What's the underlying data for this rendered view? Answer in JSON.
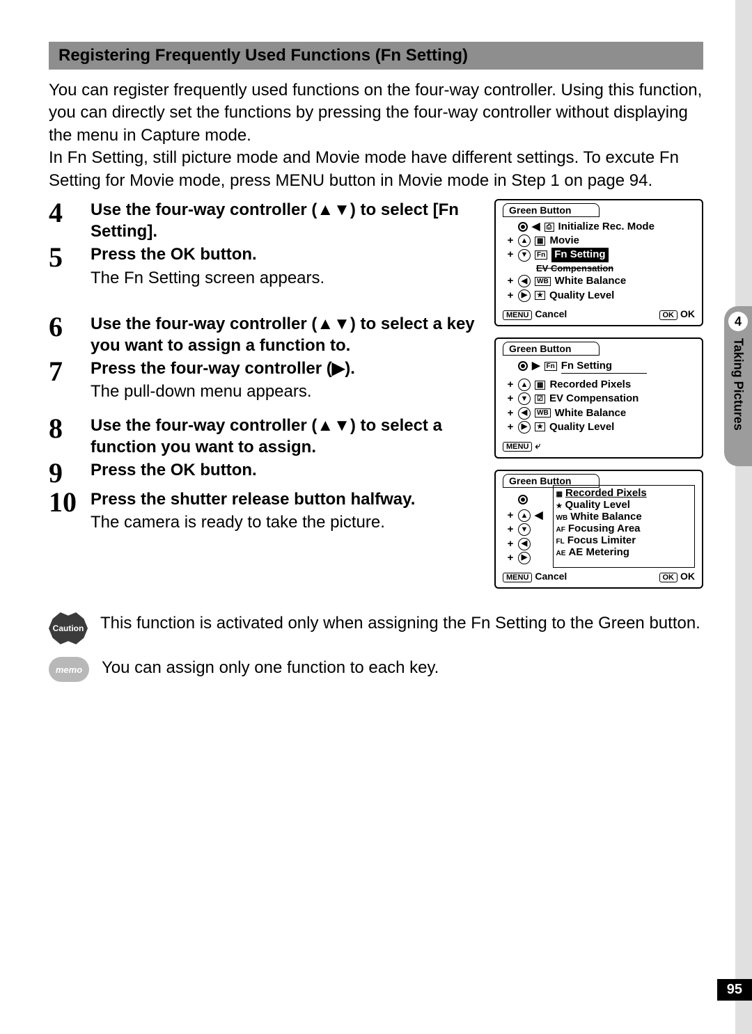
{
  "section_title": "Registering Frequently Used Functions (Fn Setting)",
  "intro": "You can register frequently used functions on the four-way controller. Using this function, you can directly set the functions by pressing the four-way controller without displaying the menu in Capture mode.\nIn Fn Setting, still picture mode and Movie mode have different settings. To excute Fn Setting for Movie mode, press MENU button in Movie mode in Step 1 on page 94.",
  "steps": [
    {
      "num": "4",
      "head": "Use the four-way controller (▲▼) to select [Fn Setting]."
    },
    {
      "num": "5",
      "head": "Press the OK button.",
      "desc": "The Fn Setting screen appears."
    },
    {
      "num": "6",
      "head": "Use the four-way controller (▲▼) to select a key you want to assign a function to."
    },
    {
      "num": "7",
      "head": "Press the four-way controller (▶).",
      "desc": "The pull-down menu appears."
    },
    {
      "num": "8",
      "head": "Use the four-way controller (▲▼) to select a function you want to assign."
    },
    {
      "num": "9",
      "head": "Press the OK button."
    },
    {
      "num": "10",
      "head": "Press the shutter release button halfway.",
      "desc": "The camera is ready to take the picture."
    }
  ],
  "fig1": {
    "tab": "Green Button",
    "rows": [
      {
        "sym": "dot",
        "icon": "◀",
        "icon2": "⎙",
        "label": "Initialize Rec. Mode"
      },
      {
        "sym": "up",
        "plus": "+",
        "icon2": "▦",
        "label": "Movie"
      },
      {
        "sym": "down",
        "plus": "+",
        "icon2": "Fn",
        "label": "Fn Setting",
        "sel": true
      },
      {
        "strike": "EV Compensation"
      },
      {
        "sym": "left",
        "plus": "+",
        "icon2": "WB",
        "label": "White Balance"
      },
      {
        "sym": "right",
        "plus": "+",
        "icon2": "★",
        "label": "Quality Level"
      }
    ],
    "footer_left_btn": "MENU",
    "footer_left": "Cancel",
    "footer_right_btn": "OK",
    "footer_right": "OK"
  },
  "fig2": {
    "tab": "Green Button",
    "navline": {
      "icon": "Fn",
      "label": "Fn Setting"
    },
    "rows": [
      {
        "sym": "up",
        "plus": "+",
        "icon2": "▦",
        "label": "Recorded Pixels"
      },
      {
        "sym": "down",
        "plus": "+",
        "icon2": "☑",
        "label": "EV Compensation"
      },
      {
        "sym": "left",
        "plus": "+",
        "icon2": "WB",
        "label": "White Balance"
      },
      {
        "sym": "right",
        "plus": "+",
        "icon2": "★",
        "label": "Quality Level"
      }
    ],
    "footer_left_btn": "MENU",
    "footer_back": "⤶"
  },
  "fig3": {
    "tab": "Green Button",
    "toprow": {
      "sym": "dot"
    },
    "dropdown": [
      {
        "ico": "▦",
        "label": "Recorded Pixels",
        "sel": true
      },
      {
        "ico": "★",
        "label": "Quality Level"
      },
      {
        "ico": "WB",
        "label": "White Balance"
      },
      {
        "ico": "AF",
        "label": "Focusing Area"
      },
      {
        "ico": "FL",
        "label": "Focus Limiter"
      },
      {
        "ico": "AE",
        "label": "AE Metering"
      }
    ],
    "siderows": [
      {
        "sym": "up",
        "plus": "+"
      },
      {
        "sym": "down",
        "plus": "+"
      },
      {
        "sym": "left",
        "plus": "+"
      },
      {
        "sym": "right",
        "plus": "+"
      }
    ],
    "footer_left_btn": "MENU",
    "footer_left": "Cancel",
    "footer_right_btn": "OK",
    "footer_right": "OK"
  },
  "sidebar": {
    "num": "4",
    "label": "Taking Pictures"
  },
  "caution": "This function is activated only when assigning the Fn Setting to the Green button.",
  "caution_badge": "Caution",
  "memo": "You can assign only one function to each key.",
  "memo_badge": "memo",
  "page_number": "95"
}
